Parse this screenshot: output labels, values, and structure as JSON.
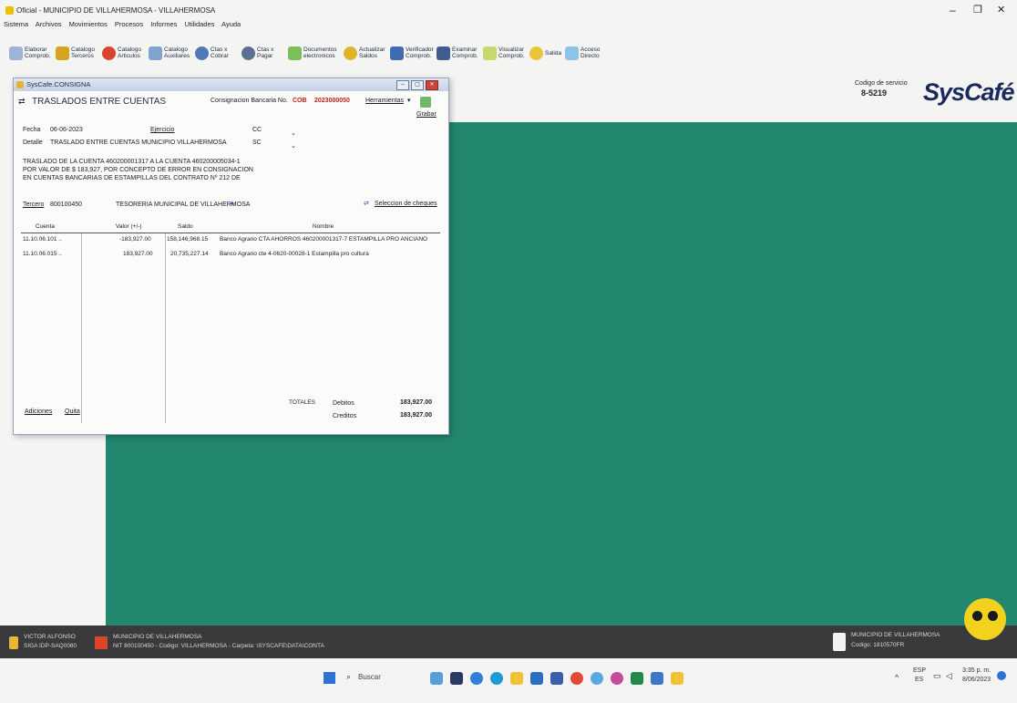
{
  "window": {
    "title": "Oficial - MUNICIPIO DE VILLAHERMOSA - VILLAHERMOSA",
    "minimize": "–",
    "maximize": "❐",
    "close": "✕"
  },
  "menu": [
    "Sistema",
    "Archivos",
    "Movimientos",
    "Procesos",
    "Informes",
    "Utilidades",
    "Ayuda"
  ],
  "toolbar": [
    {
      "label": "Elaborar Comprob.",
      "color": "#9db4d6"
    },
    {
      "label": "Catalogo Terceros",
      "color": "#d9a322"
    },
    {
      "label": "Catalogo Articulos",
      "color": "#d8442c"
    },
    {
      "label": "Catalogo Auxiliares",
      "color": "#7fa4cf"
    },
    {
      "label": "Ctas x Cobrar",
      "color": "#4e79b5"
    },
    {
      "label": "Ctas x Pagar",
      "color": "#5b6f93"
    },
    {
      "label": "Documentos electronicos",
      "color": "#7bbf5a"
    },
    {
      "label": "Actualizar Saldos",
      "color": "#e0b52d"
    },
    {
      "label": "Verificador Comprob.",
      "color": "#3f6bb0"
    },
    {
      "label": "Examinar Comprob.",
      "color": "#3f5d93"
    },
    {
      "label": "Visualizar Comprob.",
      "color": "#c8d86b"
    },
    {
      "label": "Salida",
      "color": "#e8c43a"
    },
    {
      "label": "Acceso Directo",
      "color": "#8cc3e8"
    }
  ],
  "brand": {
    "code_label": "Codigo de servicio",
    "code": "8-5219",
    "logo": "SysCafé"
  },
  "dialog": {
    "title": "SysCafe.CONSIGNA",
    "heading": "TRASLADOS ENTRE CUENTAS",
    "consignacion_label": "Consignacion Bancaria No.",
    "consignacion_code": "COB",
    "consignacion_number": "2023000050",
    "herramientas": "Herramientas",
    "grabar": "Grabar",
    "fecha_label": "Fecha",
    "fecha": "06-06-2023",
    "detalle_label": "Detalle",
    "detalle": "TRASLADO ENTRE CUENTAS MUNICIPIO VILLAHERMOSA",
    "ejercicio_label": "Ejercicio",
    "cc_label": "CC",
    "sc_label": "SC",
    "descripcion": [
      "TRASLADO DE LA CUENTA 460200001317 A LA CUENTA 460200005034-1",
      "POR VALOR DE $ 183,927, POR CONCEPTO DE ERROR EN CONSIGNACION",
      "EN CUENTAS BANCARIAS DE ESTAMPILLAS DEL CONTRATO Nº 212 DE"
    ],
    "tercero_label": "Tercero",
    "tercero_id": "800100450",
    "tercero_nombre": "TESORERIA MUNICIPAL DE VILLAHERMOSA",
    "seleccion_cheques": "Seleccion de cheques",
    "columns": [
      "Cuenta",
      "Valor (+/-)",
      "Saldo",
      "Nombre"
    ],
    "rows": [
      {
        "cuenta": "11.10.06.101 ..",
        "valor": "-183,927.00",
        "saldo": "158,146,968.15",
        "nombre": "Banco Agrario CTA AHORROS 460200001317-7 ESTAMPILLA PRO ANCIANO"
      },
      {
        "cuenta": "11.10.06.015 ..",
        "valor": "183,927.00",
        "saldo": "20,735,227.14",
        "nombre": "Banco Agrario cte 4-0620-00028-1 Estampilla pro cultura"
      }
    ],
    "adiciones": "Adiciones",
    "quita": "Quita",
    "totales_label": "TOTALES",
    "debitos_label": "Debitos",
    "debitos": "183,927.00",
    "creditos_label": "Creditos",
    "creditos": "183,927.00"
  },
  "statusbar": {
    "user_name": "VICTOR ALFONSO",
    "user_sub": "SIGA IDP-SAQ0080",
    "entity": "MUNICIPIO DE VILLAHERMOSA",
    "entity_sub": "NIT 800100450 - Codigo: VILLAHERMOSA - Carpeta: \\SYSCAFE\\DATA\\CONTA",
    "right_entity": "MUNICIPIO DE VILLAHERMOSA",
    "right_sub": "Codigo: 1810570FR"
  },
  "taskbar": {
    "search": "Buscar",
    "lang": "ESP",
    "lang_sub": "ES",
    "time": "3:35 p. m.",
    "date": "8/06/2023"
  }
}
